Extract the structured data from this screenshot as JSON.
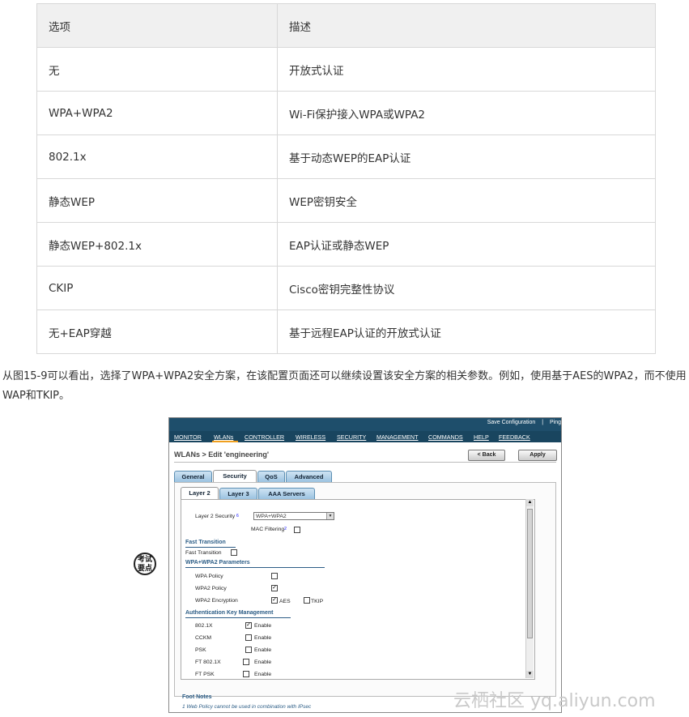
{
  "table": {
    "headers": [
      "选项",
      "描述"
    ],
    "rows": [
      [
        "无",
        "开放式认证"
      ],
      [
        "WPA+WPA2",
        "Wi-Fi保护接入WPA或WPA2"
      ],
      [
        "802.1x",
        "基于动态WEP的EAP认证"
      ],
      [
        "静态WEP",
        "WEP密钥安全"
      ],
      [
        "静态WEP+802.1x",
        "EAP认证或静态WEP"
      ],
      [
        "CKIP",
        "Cisco密钥完整性协议"
      ],
      [
        "无+EAP穿越",
        "基于远程EAP认证的开放式认证"
      ]
    ]
  },
  "paragraph": "从图15-9可以看出，选择了WPA+WPA2安全方案，在该配置页面还可以继续设置该安全方案的相关参数。例如，使用基于AES的WPA2，而不使用WAP和TKIP。",
  "badge": {
    "line1": "考试",
    "line2": "要点"
  },
  "shot": {
    "toplinks": [
      "Save Configuration",
      "|",
      "Ping"
    ],
    "menu": [
      "MONITOR",
      "WLANs",
      "CONTROLLER",
      "WIRELESS",
      "SECURITY",
      "MANAGEMENT",
      "COMMANDS",
      "HELP",
      "FEEDBACK"
    ],
    "title": "WLANs > Edit  'engineering'",
    "back_label": "< Back",
    "apply_label": "Apply",
    "tabs": [
      "General",
      "Security",
      "QoS",
      "Advanced"
    ],
    "subtabs": [
      "Layer 2",
      "Layer 3",
      "AAA Servers"
    ],
    "layer2_label": "Layer 2 Security",
    "layer2_value": "WPA+WPA2",
    "mac_label": "MAC Filtering",
    "fast_section": "Fast Transition",
    "fast_label": "Fast Transition",
    "wpa_section": "WPA+WPA2 Parameters",
    "wpa_policy": "WPA Policy",
    "wpa2_policy": "WPA2 Policy",
    "wpa2_enc": "WPA2 Encryption",
    "aes": "AES",
    "tkip": "TKIP",
    "akm_section": "Authentication Key Management",
    "akm": [
      {
        "name": "802.1X",
        "checked": true
      },
      {
        "name": "CCKM",
        "checked": false
      },
      {
        "name": "PSK",
        "checked": false
      },
      {
        "name": "FT 802.1X",
        "checked": false
      },
      {
        "name": "FT PSK",
        "checked": false
      }
    ],
    "enable": "Enable",
    "footnotes_title": "Foot Notes",
    "footnote1": "1 Web Policy cannot be used in combination with IPsec"
  },
  "watermark": "云栖社区 yq.aliyun.com"
}
